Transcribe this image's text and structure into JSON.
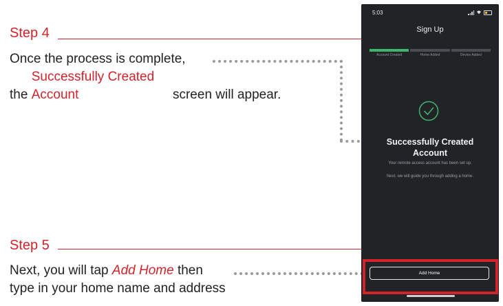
{
  "step4": {
    "title": "Step 4",
    "text_part1": "Once the process is complete,",
    "text_part2": "the ",
    "text_highlight": "Successfully Created Account",
    "text_part3": " screen will appear."
  },
  "step5": {
    "title": "Step 5",
    "text_part1": "Next, you will tap ",
    "text_highlight": "Add Home",
    "text_part2": " then",
    "text_part3": "type in your home name and address"
  },
  "phone": {
    "status_time": "5:03",
    "title": "Sign Up",
    "progress_steps": [
      {
        "label": "Account Created",
        "done": true
      },
      {
        "label": "Home Added",
        "done": false
      },
      {
        "label": "Device Added",
        "done": false
      }
    ],
    "success_title": "Successfully Created Account",
    "success_sub1": "Your remote access account has been set up.",
    "success_sub2": "Next, we will guide you through adding a home.",
    "add_home_label": "Add Home"
  },
  "colors": {
    "accent_red": "#d2232a",
    "success_green": "#3fb56b",
    "phone_bg": "#212326"
  },
  "icons": {
    "check": "check-circle-icon",
    "signal": "signal-icon",
    "wifi": "wifi-icon",
    "battery": "battery-icon"
  }
}
